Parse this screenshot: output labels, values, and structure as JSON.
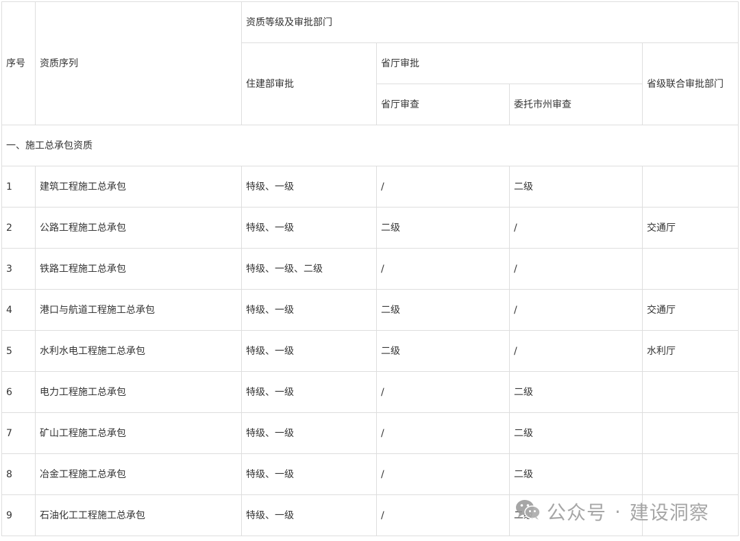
{
  "header": {
    "seq": "序号",
    "series": "资质序列",
    "grade_dept": "资质等级及审批部门",
    "moh": "住建部审批",
    "prov": "省厅审批",
    "prov_review": "省厅审查",
    "city_review": "委托市州审查",
    "joint": "省级联合审批部门"
  },
  "section": "一、施工总承包资质",
  "rows": [
    {
      "no": "1",
      "name": "建筑工程施工总承包",
      "moh": "特级、一级",
      "prov": "/",
      "city": "二级",
      "joint": ""
    },
    {
      "no": "2",
      "name": "公路工程施工总承包",
      "moh": "特级、一级",
      "prov": "二级",
      "city": "/",
      "joint": "交通厅"
    },
    {
      "no": "3",
      "name": "铁路工程施工总承包",
      "moh": "特级、一级、二级",
      "prov": "/",
      "city": "/",
      "joint": ""
    },
    {
      "no": "4",
      "name": "港口与航道工程施工总承包",
      "moh": "特级、一级",
      "prov": "二级",
      "city": "/",
      "joint": "交通厅"
    },
    {
      "no": "5",
      "name": "水利水电工程施工总承包",
      "moh": "特级、一级",
      "prov": "二级",
      "city": "/",
      "joint": "水利厅"
    },
    {
      "no": "6",
      "name": "电力工程施工总承包",
      "moh": "特级、一级",
      "prov": "/",
      "city": "二级",
      "joint": ""
    },
    {
      "no": "7",
      "name": "矿山工程施工总承包",
      "moh": "特级、一级",
      "prov": "/",
      "city": "二级",
      "joint": ""
    },
    {
      "no": "8",
      "name": "冶金工程施工总承包",
      "moh": "特级、一级",
      "prov": "/",
      "city": "二级",
      "joint": ""
    },
    {
      "no": "9",
      "name": "石油化工工程施工总承包",
      "moh": "特级、一级",
      "prov": "/",
      "city": "二级",
      "joint": ""
    }
  ],
  "watermark": {
    "icon": "wechat-icon",
    "left": "公众号",
    "dot": "·",
    "right": "建设洞察"
  }
}
